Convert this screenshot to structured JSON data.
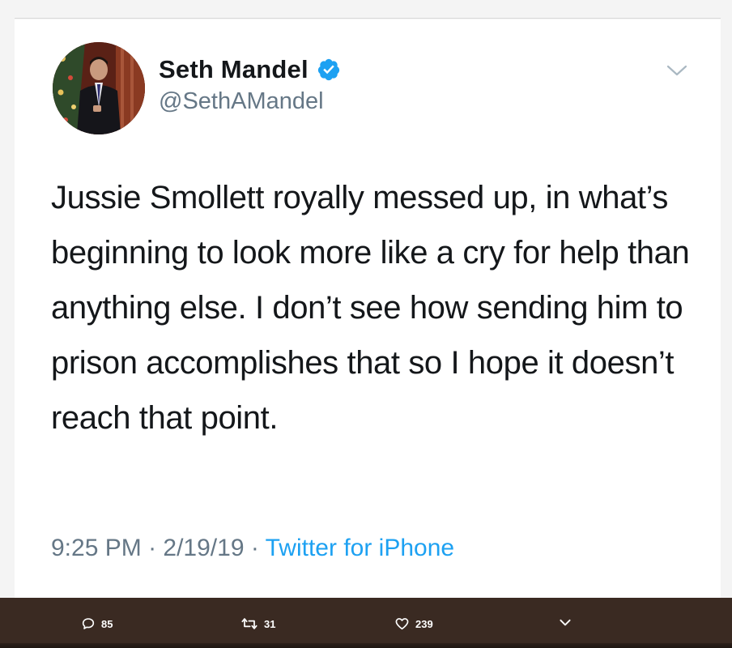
{
  "tweet": {
    "display_name": "Seth Mandel",
    "handle": "@SethAMandel",
    "verified": true,
    "text": "Jussie Smollett royally messed up, in what’s beginning to look more like a cry for help than anything else. I don’t see how sending him to prison accomplishes that so I hope it doesn’t reach that point.",
    "time": "9:25 PM",
    "separator": "·",
    "date": "2/19/19",
    "source": "Twitter for iPhone"
  },
  "actions": {
    "replies": "85",
    "retweets": "31",
    "likes": "239"
  },
  "colors": {
    "text": "#14171a",
    "secondary": "#657786",
    "accent": "#1da1f2",
    "action_bar": "#3a2a22"
  },
  "icons": {
    "verified": "verified-badge-icon",
    "menu": "chevron-down-icon",
    "reply": "speech-bubble-icon",
    "retweet": "retweet-icon",
    "like": "heart-icon",
    "more": "chevron-down-icon"
  }
}
